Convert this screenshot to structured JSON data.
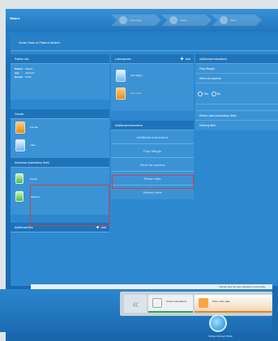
{
  "app": {
    "title": "Wake1"
  },
  "top_steps": [
    "Order data",
    "Check",
    "Send"
  ],
  "panel": {
    "title": "Order Data of Patient Wake1"
  },
  "patient": {
    "header": "Patient info",
    "rows": [
      {
        "key": "Patient",
        "value": "Wake1"
      },
      {
        "key": "Age",
        "value": "unknown"
      },
      {
        "key": "Dentist",
        "value": "Smith"
      }
    ]
  },
  "gender": {
    "header": "Gender",
    "options": [
      "Female",
      "male"
    ]
  },
  "insurance": {
    "header": "Insurance (mandatory field)",
    "options": [
      "Private",
      "Statutory"
    ]
  },
  "additional_files": {
    "header": "Additional files",
    "add_label": "Add"
  },
  "laboratories": {
    "header": "Laboratories",
    "add_label": "Add",
    "items": [
      "Lab Happy",
      "Lab Smile"
    ]
  },
  "instructions": {
    "header": "Additional instructions",
    "buttons": [
      "Additional instructions",
      "Prep Margin",
      "Send via express",
      "Return date",
      "Delivery time"
    ]
  },
  "right_col": {
    "header": "Additional instructions",
    "prep_margin": "Prep Margin",
    "send_express": "Send via express",
    "yes": "Yes",
    "no": "No",
    "return_date": "Return date (mandatory field)",
    "delivery_time": "Delivery time"
  },
  "status_message": "Dental case file was uploaded successfully.",
  "bottom_nav": {
    "back": "«",
    "check": "Check restorations",
    "enter_data": "Enter order data",
    "connect": "Sirona Connect Portal"
  }
}
